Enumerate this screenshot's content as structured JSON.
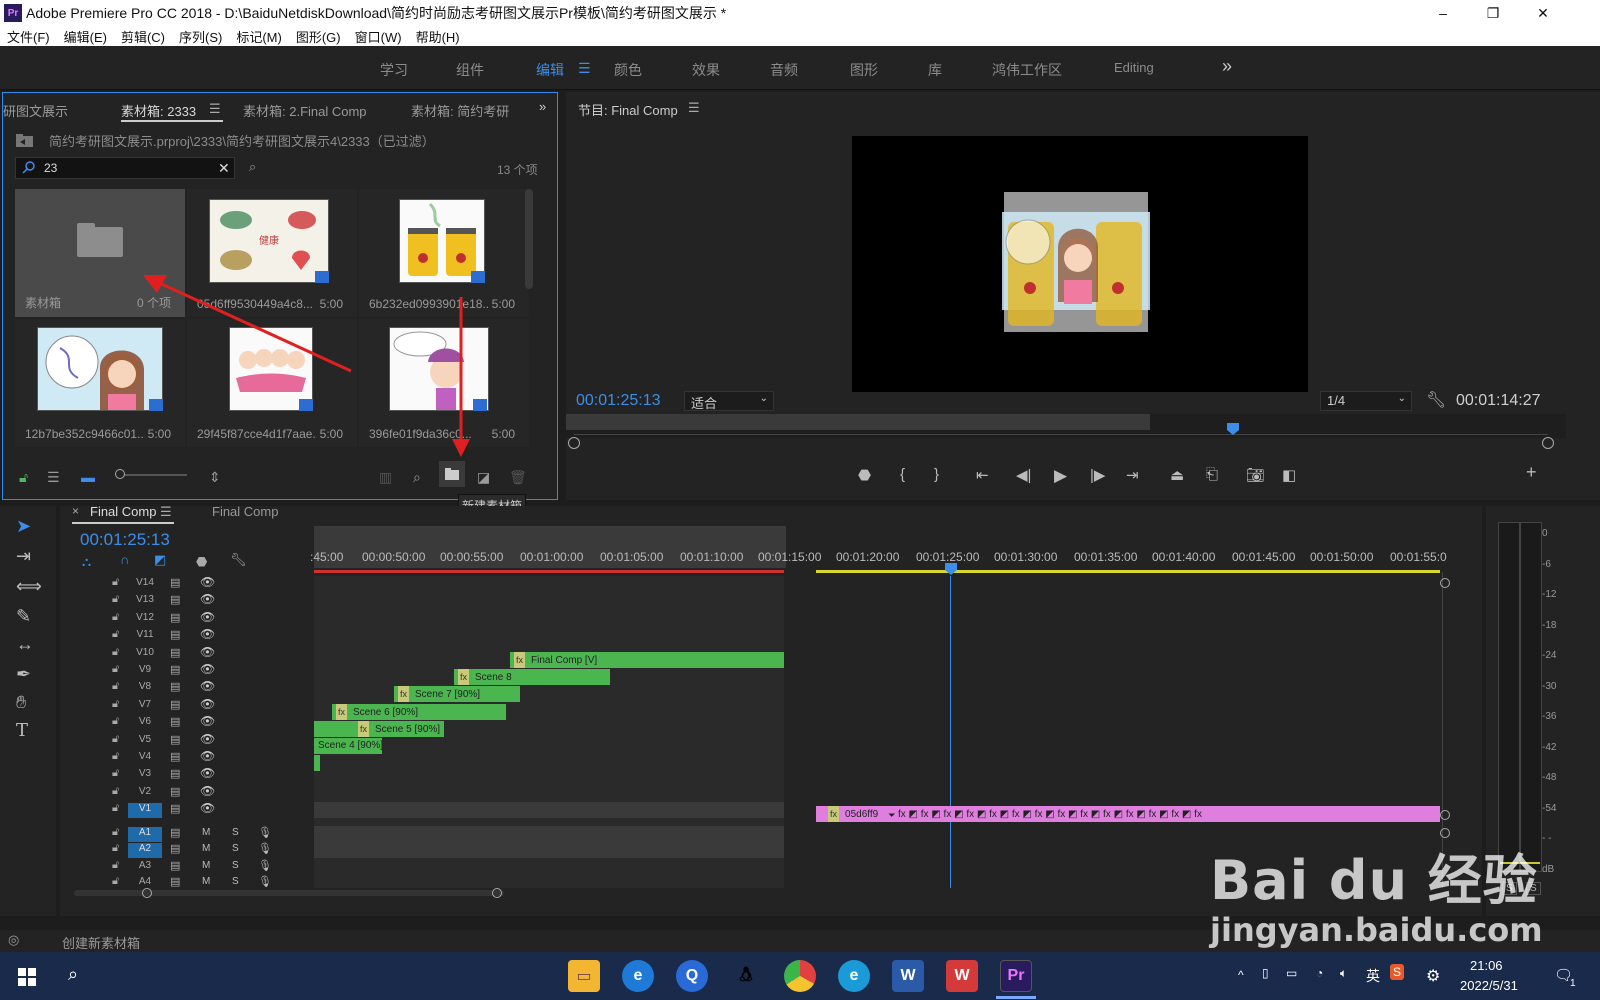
{
  "window": {
    "app_badge": "Pr",
    "title": "Adobe Premiere Pro CC 2018 - D:\\BaiduNetdiskDownload\\简约时尚励志考研图文展示Pr模板\\简约考研图文展示 *",
    "minimize": "–",
    "restore": "❐",
    "close": "✕"
  },
  "menu": [
    "文件(F)",
    "编辑(E)",
    "剪辑(C)",
    "序列(S)",
    "标记(M)",
    "图形(G)",
    "窗口(W)",
    "帮助(H)"
  ],
  "workspaces": {
    "items": [
      "学习",
      "组件",
      "编辑",
      "颜色",
      "效果",
      "音频",
      "图形",
      "库",
      "鸿伟工作区",
      "Editing"
    ],
    "active": "编辑",
    "more": "»"
  },
  "project_panel": {
    "tabs": [
      "研图文展示",
      "素材箱: 2333",
      "素材箱: 2.Final Comp",
      "素材箱: 简约考研"
    ],
    "active_tab": "素材箱: 2333",
    "breadcrumb": "简约考研图文展示.prproj\\2333\\简约考研图文展示4\\2333（已过滤）",
    "search_value": "23",
    "item_count": "13 个项",
    "items": [
      {
        "name": "素材箱",
        "duration": "0 个项",
        "kind": "bin"
      },
      {
        "name": "05d6ff9530449a4c8...",
        "duration": "5:00",
        "kind": "image"
      },
      {
        "name": "6b232ed0993901e18...",
        "duration": "5:00",
        "kind": "image"
      },
      {
        "name": "12b7be352c9466c01...",
        "duration": "5:00",
        "kind": "image"
      },
      {
        "name": "29f45f87cce4d1f7aae...",
        "duration": "5:00",
        "kind": "image"
      },
      {
        "name": "396fe01f9da36c0...",
        "duration": "5:00",
        "kind": "image"
      }
    ],
    "tooltip": "新建素材箱"
  },
  "program_monitor": {
    "title": "节目: Final Comp",
    "current_timecode": "00:01:25:13",
    "fit": "适合",
    "resolution": "1/4",
    "duration": "00:01:14:27"
  },
  "timeline": {
    "tabs": [
      "Final Comp",
      "Final Comp"
    ],
    "timecode": "00:01:25:13",
    "ruler": [
      ":45:00",
      "00:00:50:00",
      "00:00:55:00",
      "00:01:00:00",
      "00:01:05:00",
      "00:01:10:00",
      "00:01:15:00",
      "00:01:20:00",
      "00:01:25:00",
      "00:01:30:00",
      "00:01:35:00",
      "00:01:40:00",
      "00:01:45:00",
      "00:01:50:00",
      "00:01:55:0"
    ],
    "video_tracks": [
      "V14",
      "V13",
      "V12",
      "V11",
      "V10",
      "V9",
      "V8",
      "V7",
      "V6",
      "V5",
      "V4",
      "V3",
      "V2",
      "V1"
    ],
    "audio_tracks": [
      "A1",
      "A2",
      "A3",
      "A4"
    ],
    "clips": [
      {
        "track": "V10",
        "label": "Final Comp [V]"
      },
      {
        "track": "V9",
        "label": "Scene 8"
      },
      {
        "track": "V8",
        "label": "Scene 7 [90%]"
      },
      {
        "track": "V7",
        "label": "Scene 6 [90%]"
      },
      {
        "track": "V6",
        "label": "Scene 5 [90%]"
      },
      {
        "track": "V5",
        "label": "Scene 4 [90%]"
      },
      {
        "track": "V1",
        "label": "05d6ff9"
      }
    ],
    "mute_label": "M",
    "solo_label": "S"
  },
  "audio_meter": {
    "scale": [
      "0",
      "-6",
      "-12",
      "-18",
      "-24",
      "-30",
      "-36",
      "-42",
      "-48",
      "-54",
      "- -",
      "dB"
    ],
    "solo_left": "S",
    "solo_right": "S"
  },
  "status_bar": "创建新素材箱",
  "taskbar": {
    "ime": "英",
    "time": "21:06",
    "date": "2022/5/31",
    "notification_count": "1"
  },
  "watermark": {
    "brand": "Bai du 经验",
    "url": "jingyan.baidu.com"
  },
  "colors": {
    "accent": "#2d8ceb",
    "clip_green": "#4bb550",
    "clip_pink": "#e07ee0",
    "playhead": "#3c8ee8"
  }
}
